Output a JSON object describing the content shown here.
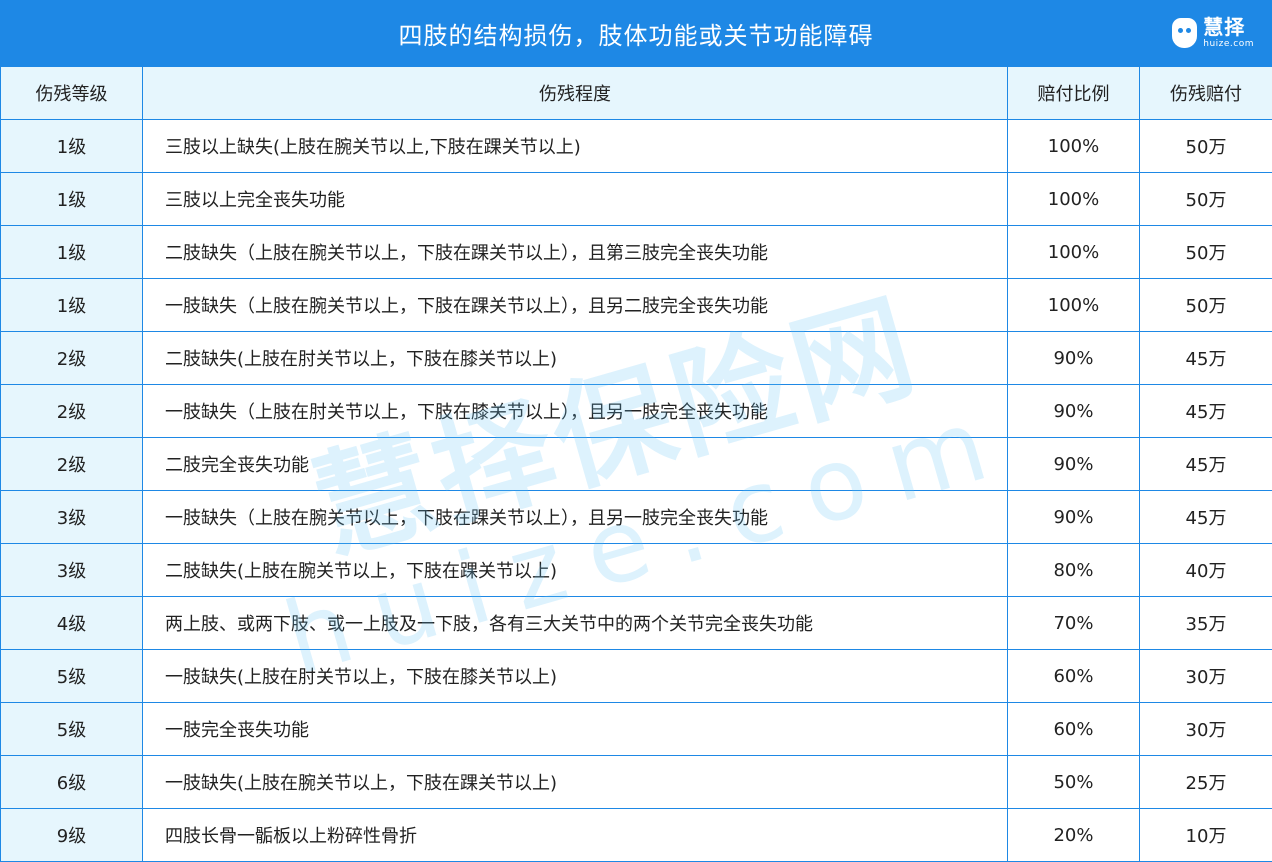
{
  "title": "四肢的结构损伤，肢体功能或关节功能障碍",
  "logo": {
    "main": "慧择",
    "sub": "huize.com"
  },
  "headers": [
    "伤残等级",
    "伤残程度",
    "赔付比例",
    "伤残赔付"
  ],
  "rows": [
    {
      "grade": "1级",
      "desc": "三肢以上缺失(上肢在腕关节以上,下肢在踝关节以上)",
      "ratio": "100%",
      "pay": "50万"
    },
    {
      "grade": "1级",
      "desc": "三肢以上完全丧失功能",
      "ratio": "100%",
      "pay": "50万"
    },
    {
      "grade": "1级",
      "desc": "二肢缺失（上肢在腕关节以上，下肢在踝关节以上），且第三肢完全丧失功能",
      "ratio": "100%",
      "pay": "50万"
    },
    {
      "grade": "1级",
      "desc": "一肢缺失（上肢在腕关节以上，下肢在踝关节以上），且另二肢完全丧失功能",
      "ratio": "100%",
      "pay": "50万"
    },
    {
      "grade": "2级",
      "desc": "二肢缺失(上肢在肘关节以上，下肢在膝关节以上)",
      "ratio": "90%",
      "pay": "45万"
    },
    {
      "grade": "2级",
      "desc": "一肢缺失（上肢在肘关节以上，下肢在膝关节以上），且另一肢完全丧失功能",
      "ratio": "90%",
      "pay": "45万"
    },
    {
      "grade": "2级",
      "desc": "二肢完全丧失功能",
      "ratio": "90%",
      "pay": "45万"
    },
    {
      "grade": "3级",
      "desc": "一肢缺失（上肢在腕关节以上，下肢在踝关节以上），且另一肢完全丧失功能",
      "ratio": "90%",
      "pay": "45万"
    },
    {
      "grade": "3级",
      "desc": "二肢缺失(上肢在腕关节以上，下肢在踝关节以上)",
      "ratio": "80%",
      "pay": "40万"
    },
    {
      "grade": "4级",
      "desc": "两上肢、或两下肢、或一上肢及一下肢，各有三大关节中的两个关节完全丧失功能",
      "ratio": "70%",
      "pay": "35万"
    },
    {
      "grade": "5级",
      "desc": "一肢缺失(上肢在肘关节以上，下肢在膝关节以上)",
      "ratio": "60%",
      "pay": "30万"
    },
    {
      "grade": "5级",
      "desc": "一肢完全丧失功能",
      "ratio": "60%",
      "pay": "30万"
    },
    {
      "grade": "6级",
      "desc": "一肢缺失(上肢在腕关节以上，下肢在踝关节以上)",
      "ratio": "50%",
      "pay": "25万"
    },
    {
      "grade": "9级",
      "desc": "四肢长骨一骺板以上粉碎性骨折",
      "ratio": "20%",
      "pay": "10万"
    }
  ],
  "watermark": {
    "main": "慧择保险网",
    "sub": "huize.com"
  },
  "colors": {
    "accent": "#1e88e5",
    "header_bg": "#e6f6fd"
  }
}
